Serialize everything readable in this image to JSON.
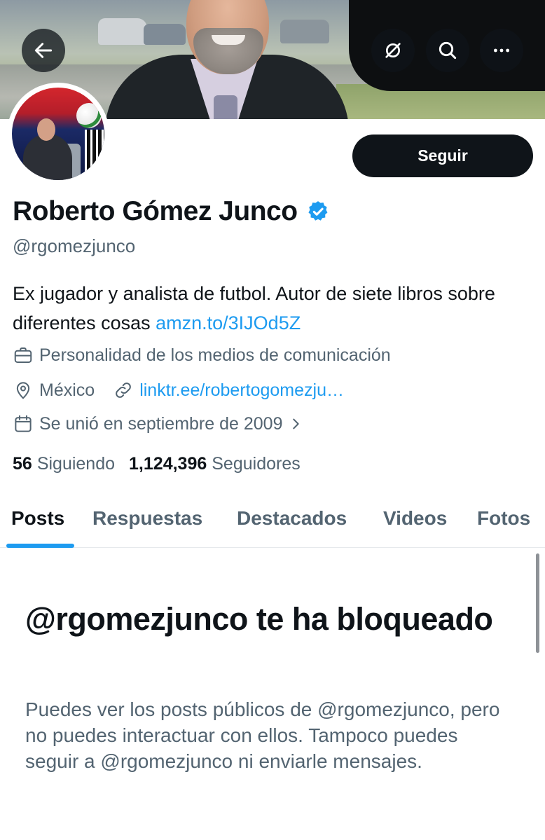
{
  "header": {
    "back_icon": "arrow-left-icon",
    "grok_icon": "grok-icon",
    "search_icon": "search-icon",
    "more_icon": "more-horizontal-icon"
  },
  "profile": {
    "follow_label": "Seguir",
    "name": "Roberto Gómez Junco",
    "verified": true,
    "handle": "@rgomezjunco",
    "bio_text": "Ex jugador y analista de futbol. Autor de siete libros sobre diferentes cosas ",
    "bio_link": "amzn.to/3IJOd5Z",
    "category": "Personalidad de los medios de comunicación",
    "location": "México",
    "website": "linktr.ee/robertogomezju…",
    "joined": "Se unió en septiembre de 2009",
    "following_count": "56",
    "following_label": "Siguiendo",
    "followers_count": "1,124,396",
    "followers_label": "Seguidores"
  },
  "tabs": [
    {
      "label": "Posts",
      "active": true
    },
    {
      "label": "Respuestas",
      "active": false
    },
    {
      "label": "Destacados",
      "active": false
    },
    {
      "label": "Videos",
      "active": false
    },
    {
      "label": "Fotos",
      "active": false
    }
  ],
  "blocked": {
    "title": "@rgomezjunco te ha bloqueado",
    "description": "Puedes ver los posts públicos de @rgomezjunco, pero no puedes interactuar con ellos. Tampoco puedes seguir a @rgomezjunco ni enviarle mensajes."
  },
  "colors": {
    "accent": "#1d9bf0",
    "text_primary": "#0f1419",
    "text_secondary": "#536471"
  }
}
